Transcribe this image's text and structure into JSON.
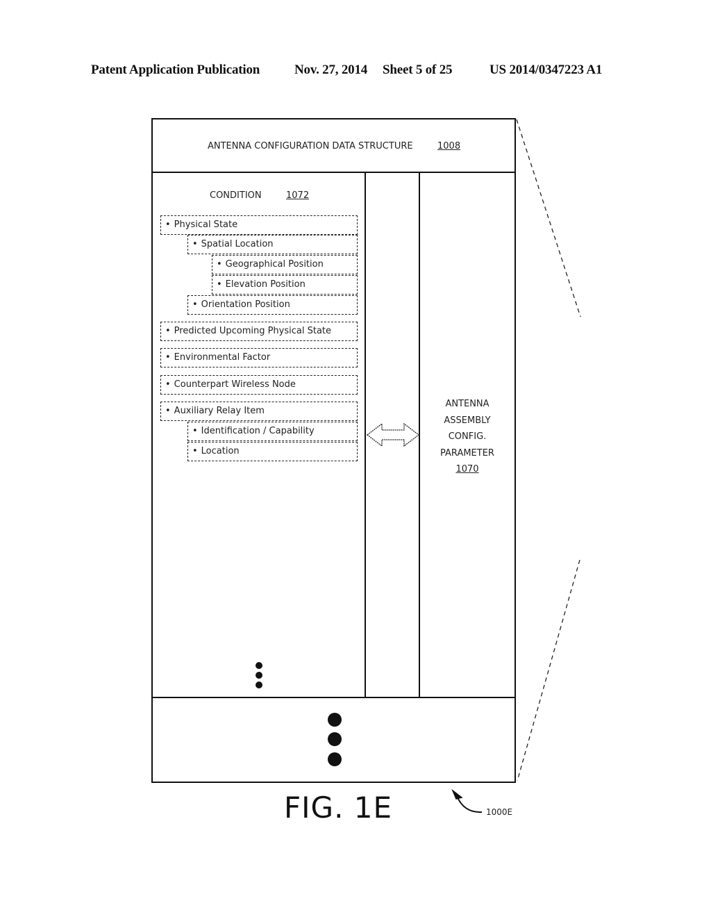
{
  "header": {
    "publication": "Patent Application Publication",
    "date": "Nov. 27, 2014",
    "sheet": "Sheet 5 of 25",
    "patent_number": "US 2014/0347223 A1"
  },
  "diagram": {
    "title": "ANTENNA CONFIGURATION DATA STRUCTURE",
    "title_ref": "1008",
    "condition": {
      "label": "CONDITION",
      "ref": "1072",
      "items": [
        {
          "level": 0,
          "text": "Physical State"
        },
        {
          "level": 1,
          "text": "Spatial Location"
        },
        {
          "level": 2,
          "text": "Geographical Position"
        },
        {
          "level": 2,
          "text": "Elevation Position"
        },
        {
          "level": 1,
          "text": "Orientation Position"
        },
        {
          "level": 0,
          "text": "Predicted Upcoming Physical State"
        },
        {
          "level": 0,
          "text": "Environmental Factor"
        },
        {
          "level": 0,
          "text": "Counterpart Wireless Node"
        },
        {
          "level": 0,
          "text": "Auxiliary Relay Item"
        },
        {
          "level": 1,
          "text": "Identification / Capability"
        },
        {
          "level": 1,
          "text": "Location"
        }
      ],
      "bullet": "•",
      "continuation": "more-items-ellipsis"
    },
    "association_arrow": "double-headed-arrow",
    "parameter": {
      "lines": [
        "ANTENNA",
        "ASSEMBLY",
        "CONFIG.",
        "PARAMETER"
      ],
      "ref": "1070"
    },
    "more_entries": "additional-entries-ellipsis"
  },
  "figure": {
    "label": "FIG. 1E",
    "reference": "1000E"
  }
}
